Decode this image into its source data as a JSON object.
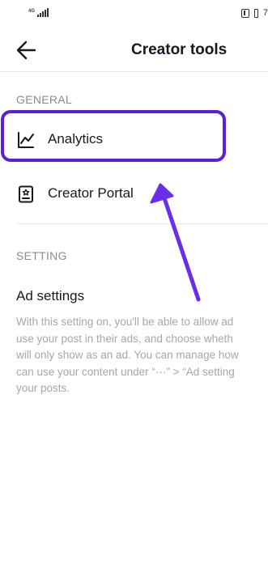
{
  "status_bar": {
    "network": "4G",
    "battery": "7"
  },
  "header": {
    "title": "Creator tools"
  },
  "general": {
    "label": "GENERAL",
    "items": [
      {
        "label": "Analytics"
      },
      {
        "label": "Creator Portal"
      }
    ]
  },
  "setting": {
    "label": "SETTING",
    "ad_title": "Ad settings",
    "ad_description_lines": [
      "With this setting on, you'll be able to allow ad",
      "use your post in their ads, and choose wheth",
      "will only show as an ad. You can manage how",
      "can use your content under “···” > “Ad setting",
      "your posts."
    ]
  },
  "annotation": {
    "highlight_color": "#5b1fd6",
    "arrow_color": "#6a2ee8"
  }
}
